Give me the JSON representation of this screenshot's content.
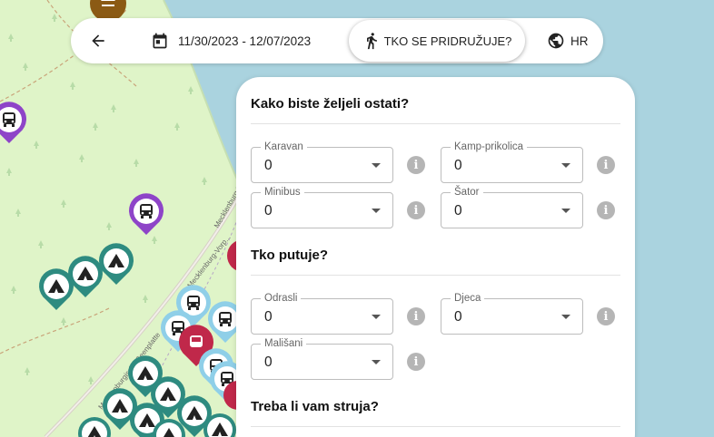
{
  "map": {
    "road_name_1": "Mecklenburg-Vorp...",
    "road_name_2": "Mecklenburgische Seenplatte",
    "road_name_3": "Mecklenburg-Vorpommern"
  },
  "topbar": {
    "dates": "11/30/2023 - 12/07/2023",
    "guests_label": "TKO SE PRIDRUŽUJE?",
    "language": "HR"
  },
  "panel": {
    "stay_title": "Kako biste željeli ostati?",
    "stay_fields": [
      {
        "label": "Karavan",
        "value": "0"
      },
      {
        "label": "Kamp-prikolica",
        "value": "0"
      },
      {
        "label": "Minibus",
        "value": "0"
      },
      {
        "label": "Šator",
        "value": "0"
      }
    ],
    "travel_title": "Tko putuje?",
    "travel_fields": [
      {
        "label": "Odrasli",
        "value": "0"
      },
      {
        "label": "Djeca",
        "value": "0"
      },
      {
        "label": "Mališani",
        "value": "0"
      }
    ],
    "power_title": "Treba li vam struja?",
    "info_glyph": "i"
  },
  "colors": {
    "land": "#dff4c8",
    "water": "#aad3df",
    "purple_marker": "#8e44c8",
    "teal_marker": "#2e8b80",
    "light_blue_marker": "#8fcfe8",
    "red_marker": "#c0284a",
    "brown_marker": "#8b5a14"
  }
}
